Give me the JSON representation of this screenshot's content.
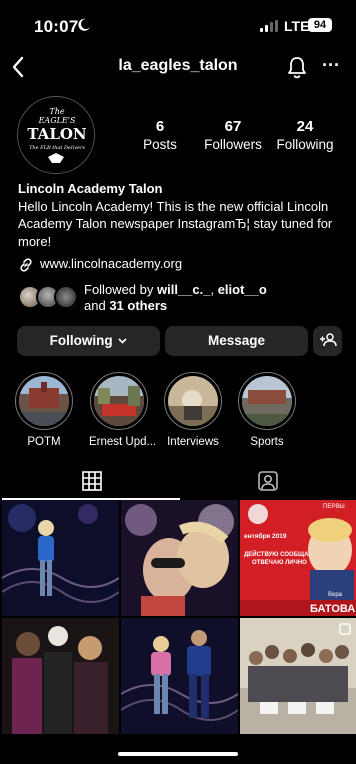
{
  "status_bar": {
    "time": "10:07",
    "network": "LTE",
    "battery": "94"
  },
  "nav": {
    "username": "la_eagles_talon"
  },
  "profile": {
    "logo_line1": "The",
    "logo_line2": "EAGLE'S",
    "logo_line3": "TALON",
    "logo_tagline": "The FLB that Delivers",
    "posts_count": "6",
    "posts_label": "Posts",
    "followers_count": "67",
    "followers_label": "Followers",
    "following_count": "24",
    "following_label": "Following",
    "display_name": "Lincoln Academy Talon",
    "bio_text": "Hello Lincoln Academy! This is the new official Lincoln Academy Talon newspaper InstagramЂ¦ stay tuned for more!",
    "website": "www.lincolnacademy.org",
    "followed_by_prefix": "Followed by ",
    "followed_by_user1": "will__c._",
    "followed_by_sep": ", ",
    "followed_by_user2": "eliot__o",
    "followed_by_and": "and ",
    "followed_by_others": "31 others"
  },
  "buttons": {
    "following": "Following",
    "message": "Message"
  },
  "highlights": [
    {
      "label": "POTM"
    },
    {
      "label": "Ernest Upd..."
    },
    {
      "label": "Interviews"
    },
    {
      "label": "Sports"
    }
  ],
  "posts": [
    {
      "kind": "photo"
    },
    {
      "kind": "photo"
    },
    {
      "kind": "poster",
      "date_text": "ентября 2019",
      "line1": "ДЕЙСТВУЮ СООБЩА,",
      "line2": "ОТВЕЧАЮ ЛИЧНО",
      "first_name": "Вера",
      "last_name": "БАТОВА",
      "label_small": "ПЕРВЫ"
    },
    {
      "kind": "photo"
    },
    {
      "kind": "photo"
    },
    {
      "kind": "photo"
    }
  ],
  "colors": {
    "background": "#000000",
    "button": "#262626",
    "poster_red": "#d21f26"
  }
}
